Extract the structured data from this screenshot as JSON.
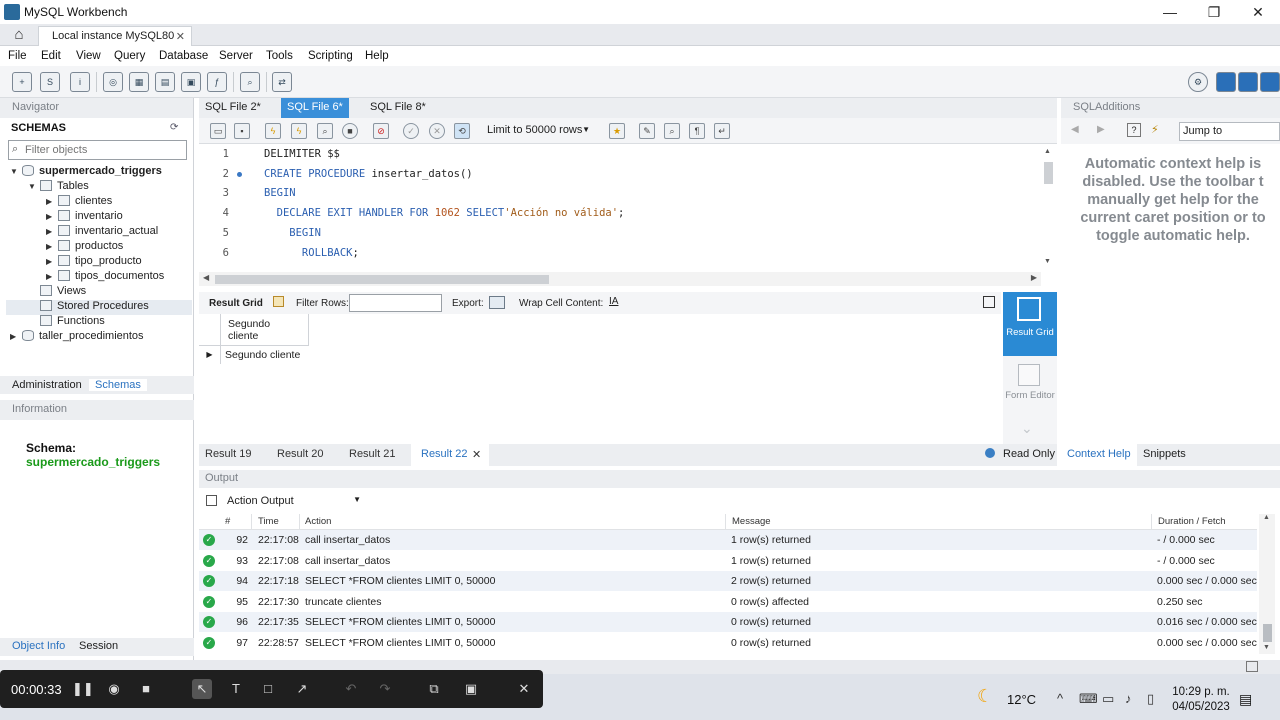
{
  "window": {
    "title": "MySQL Workbench",
    "connection_tab": "Local instance MySQL80",
    "close_glyph": "✕"
  },
  "menu": [
    "File",
    "Edit",
    "View",
    "Query",
    "Database",
    "Server",
    "Tools",
    "Scripting",
    "Help"
  ],
  "navigator": {
    "header": "Navigator",
    "schemas_title": "SCHEMAS",
    "filter_placeholder": "Filter objects",
    "tree": {
      "schema": "supermercado_triggers",
      "tables_label": "Tables",
      "tables": [
        "clientes",
        "inventario",
        "inventario_actual",
        "productos",
        "tipo_producto",
        "tipos_documentos"
      ],
      "views": "Views",
      "stored_procedures": "Stored Procedures",
      "functions": "Functions",
      "other_schema": "taller_procedimientos"
    },
    "tabs": [
      "Administration",
      "Schemas"
    ],
    "information_header": "Information",
    "schema_label": "Schema:",
    "schema_value": "supermercado_triggers",
    "bottom_tabs": [
      "Object Info",
      "Session"
    ]
  },
  "editor": {
    "tabs": [
      "SQL File 2*",
      "SQL File 6*",
      "SQL File 8*"
    ],
    "active_tab": 1,
    "limit": "Limit to 50000 rows",
    "lines": [
      {
        "n": "1",
        "parts": [
          {
            "t": "DELIMITER $$",
            "c": ""
          }
        ]
      },
      {
        "n": "2",
        "parts": [
          {
            "t": "CREATE PROCEDURE",
            "c": "kw"
          },
          {
            "t": " insertar_datos()",
            "c": ""
          }
        ]
      },
      {
        "n": "3",
        "parts": [
          {
            "t": "BEGIN",
            "c": "kw"
          }
        ]
      },
      {
        "n": "4",
        "parts": [
          {
            "t": "  DECLARE EXIT HANDLER FOR ",
            "c": "kw"
          },
          {
            "t": "1062",
            "c": "num"
          },
          {
            "t": " SELECT",
            "c": "kw"
          },
          {
            "t": "'Acción no válida'",
            "c": "str"
          },
          {
            "t": ";",
            "c": ""
          }
        ]
      },
      {
        "n": "5",
        "parts": [
          {
            "t": "    BEGIN",
            "c": "kw"
          }
        ]
      },
      {
        "n": "6",
        "parts": [
          {
            "t": "      ROLLBACK",
            "c": "kw"
          },
          {
            "t": ";",
            "c": ""
          }
        ]
      }
    ]
  },
  "result_toolbar": {
    "result_grid": "Result Grid",
    "filter_rows": "Filter Rows:",
    "export": "Export:",
    "wrap": "Wrap Cell Content:"
  },
  "grid": {
    "column": "Segundo cliente",
    "rows": [
      "Segundo cliente"
    ]
  },
  "side_buttons": {
    "result_grid": "Result Grid",
    "form_editor": "Form Editor"
  },
  "result_tabs": [
    "Result 19",
    "Result 20",
    "Result 21",
    "Result 22"
  ],
  "active_result_tab": 3,
  "read_only": "Read Only",
  "output": {
    "header": "Output",
    "mode": "Action Output",
    "columns": [
      "#",
      "Time",
      "Action",
      "Message",
      "Duration / Fetch"
    ],
    "rows": [
      {
        "n": "92",
        "time": "22:17:08",
        "action": "call insertar_datos",
        "message": "1 row(s) returned",
        "duration": "- / 0.000 sec"
      },
      {
        "n": "93",
        "time": "22:17:08",
        "action": "call insertar_datos",
        "message": "1 row(s) returned",
        "duration": "- / 0.000 sec"
      },
      {
        "n": "94",
        "time": "22:17:18",
        "action": "SELECT *FROM clientes LIMIT 0, 50000",
        "message": "2 row(s) returned",
        "duration": "0.000 sec / 0.000 sec"
      },
      {
        "n": "95",
        "time": "22:17:30",
        "action": "truncate clientes",
        "message": "0 row(s) affected",
        "duration": "0.250 sec"
      },
      {
        "n": "96",
        "time": "22:17:35",
        "action": "SELECT *FROM clientes LIMIT 0, 50000",
        "message": "0 row(s) returned",
        "duration": "0.016 sec / 0.000 sec"
      },
      {
        "n": "97",
        "time": "22:28:57",
        "action": "SELECT *FROM clientes LIMIT 0, 50000",
        "message": "0 row(s) returned",
        "duration": "0.000 sec / 0.000 sec"
      }
    ]
  },
  "sql_additions": {
    "header": "SQLAdditions",
    "jump_to": "Jump to",
    "context_help": "Automatic context help is\ndisabled. Use the toolbar t\nmanually get help for the\ncurrent caret position or to\ntoggle automatic help.",
    "tabs": [
      "Context Help",
      "Snippets"
    ]
  },
  "recorder": {
    "time": "00:00:33"
  },
  "tray": {
    "temperature": "12°C",
    "time": "10:29 p. m.",
    "date": "04/05/2023"
  },
  "colors": {
    "accent": "#3a8fd9",
    "success": "#29a84a",
    "schema_green": "#1a9a1a"
  }
}
